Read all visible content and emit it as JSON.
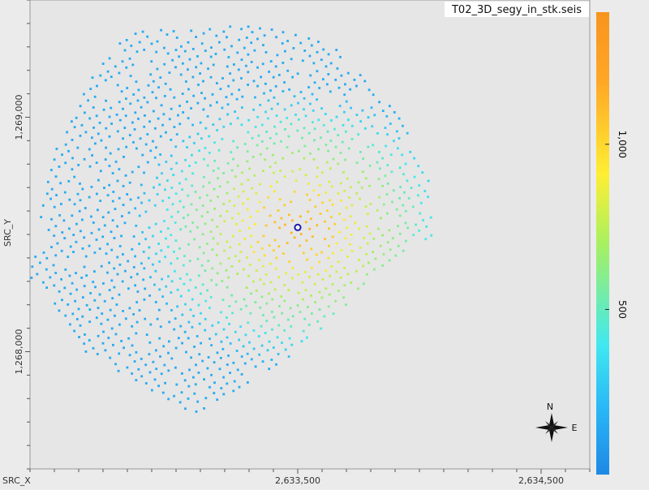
{
  "window": {
    "file_label": "T02_3D_segy_in_stk.seis"
  },
  "compass": {
    "north_label": "N",
    "east_label": "E"
  },
  "chart_data": {
    "type": "scatter",
    "title": "T02_3D_segy_in_stk.seis",
    "xlabel": "SRC_X",
    "ylabel": "SRC_Y",
    "x_ticks": [
      {
        "value": 2633500,
        "label": "2,633,500"
      },
      {
        "value": 2634500,
        "label": "2,634,500"
      }
    ],
    "y_ticks": [
      {
        "value": 1269000,
        "label": "1,269,000"
      },
      {
        "value": 1268000,
        "label": "1,268,000"
      }
    ],
    "xlim": [
      2632400,
      2634700
    ],
    "ylim": [
      1267500,
      1269500
    ],
    "grid": false,
    "colorbar": {
      "placement": "right",
      "range": [
        0,
        1400
      ],
      "ticks": [
        {
          "value": 500,
          "label": "500"
        },
        {
          "value": 1000,
          "label": "1,000"
        }
      ],
      "colors": [
        "#1e88e5",
        "#29b6f6",
        "#40e8f0",
        "#a8f060",
        "#ffee33",
        "#ffa726",
        "#f7941d"
      ],
      "color_stops": [
        0,
        0.14,
        0.28,
        0.5,
        0.65,
        0.85,
        1
      ]
    },
    "survey_outline": [
      [
        2632800,
        1269370
      ],
      [
        2633300,
        1269400
      ],
      [
        2633650,
        1269310
      ],
      [
        2633900,
        1269050
      ],
      [
        2634050,
        1268720
      ],
      [
        2634050,
        1268480
      ],
      [
        2633850,
        1268350
      ],
      [
        2633500,
        1268000
      ],
      [
        2633150,
        1267750
      ],
      [
        2633050,
        1267740
      ],
      [
        2632870,
        1267840
      ],
      [
        2632600,
        1268020
      ],
      [
        2632400,
        1268320
      ],
      [
        2632480,
        1268800
      ],
      [
        2632580,
        1269040
      ],
      [
        2632700,
        1269250
      ]
    ],
    "peak_center": [
      2633500,
      1268530
    ],
    "peak_value": 1300,
    "edge_value": 150,
    "selected_point": [
      2633500,
      1268530
    ],
    "sample_spacing": 35
  },
  "colors": {
    "plot_background": "#e6e6e6",
    "axis": "#555555",
    "marker": "#1a1aa8"
  }
}
